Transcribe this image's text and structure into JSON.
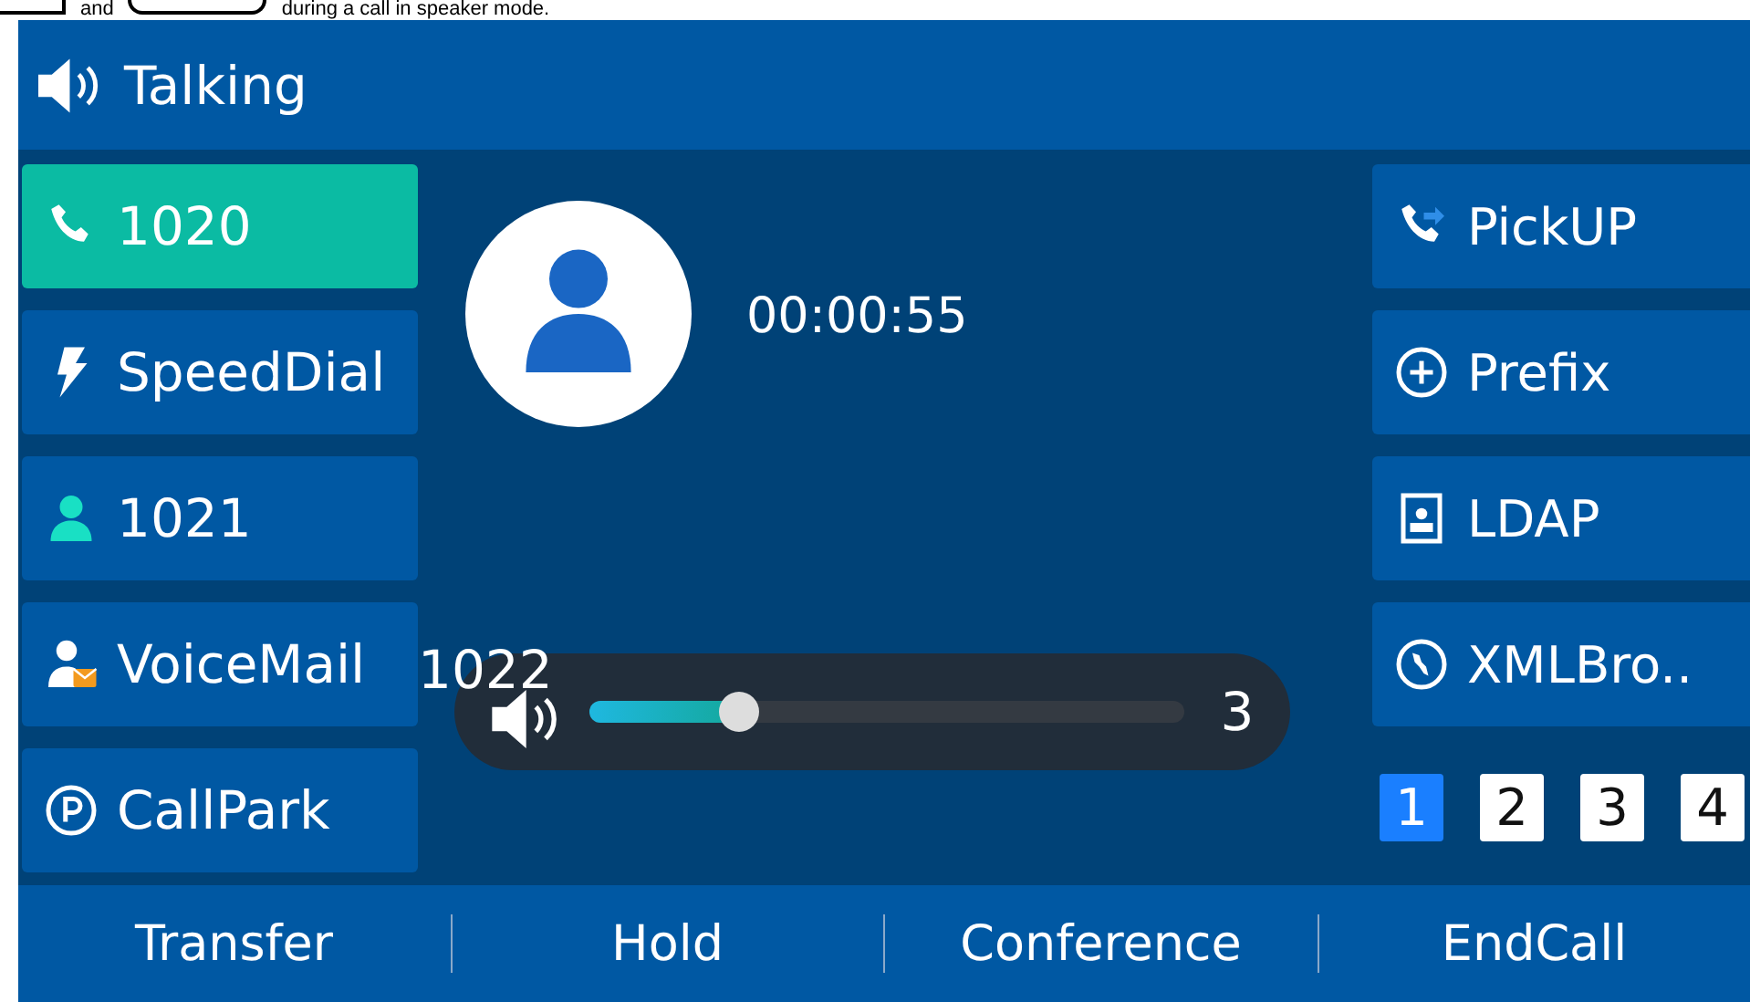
{
  "caption": [
    {
      "kind": "key"
    },
    {
      "kind": "text",
      "text": "and"
    },
    {
      "kind": "key"
    },
    {
      "kind": "text",
      "text": "during a call in speaker mode."
    }
  ],
  "title": "Talking",
  "left_keys": [
    {
      "label": "1020",
      "kind": "line",
      "selected": true
    },
    {
      "label": "SpeedDial",
      "kind": "speeddial",
      "selected": false
    },
    {
      "label": "1021",
      "kind": "blf",
      "selected": false
    },
    {
      "label": "VoiceMail",
      "kind": "voicemail",
      "selected": false
    },
    {
      "label": "CallPark",
      "kind": "callpark",
      "selected": false
    }
  ],
  "call": {
    "timer": "00:00:55",
    "contact": "1022"
  },
  "volume": {
    "level": 0.25,
    "reading": "3"
  },
  "right_keys": [
    {
      "label": "PickUP",
      "kind": "pickup"
    },
    {
      "label": "Prefix",
      "kind": "prefix"
    },
    {
      "label": "LDAP",
      "kind": "ldap"
    },
    {
      "label": "XMLBro..",
      "kind": "xmlbrowser"
    }
  ],
  "pages": [
    {
      "label": "1",
      "selected": true
    },
    {
      "label": "2",
      "selected": false
    },
    {
      "label": "3",
      "selected": false
    },
    {
      "label": "4",
      "selected": false
    }
  ],
  "softkeys": [
    "Transfer",
    "Hold",
    "Conference",
    "EndCall"
  ]
}
